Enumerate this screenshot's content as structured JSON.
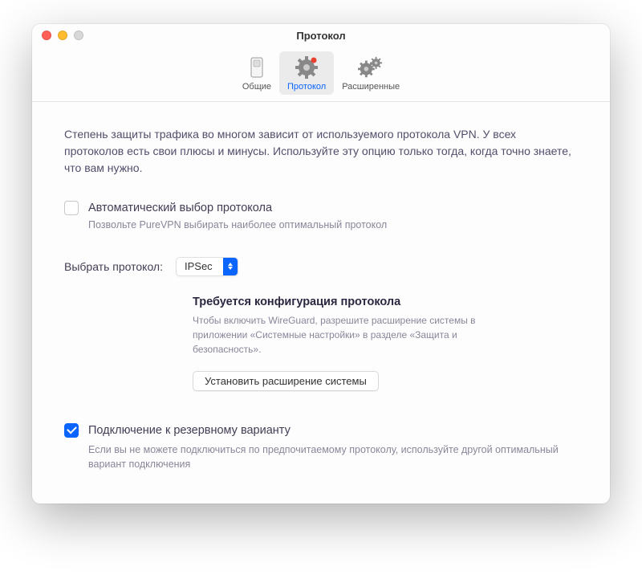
{
  "window": {
    "title": "Протокол"
  },
  "toolbar": {
    "items": [
      {
        "label": "Общие"
      },
      {
        "label": "Протокол"
      },
      {
        "label": "Расширенные"
      }
    ]
  },
  "main": {
    "intro": "Степень защиты трафика во многом зависит от используемого протокола VPN. У всех протоколов есть свои плюсы и минусы. Используйте эту опцию только тогда, когда точно знаете, что вам нужно.",
    "auto_protocol": {
      "label": "Автоматический выбор протокола",
      "desc": "Позвольте PureVPN выбирать наиболее оптимальный протокол",
      "checked": false
    },
    "select": {
      "label": "Выбрать протокол:",
      "value": "IPSec"
    },
    "config": {
      "title": "Требуется конфигурация протокола",
      "desc": "Чтобы включить WireGuard, разрешите расширение системы в приложении «Системные настройки» в разделе «Защита и безопасность».",
      "button": "Установить расширение системы"
    },
    "fallback": {
      "label": "Подключение к резервному варианту",
      "desc": "Если вы не можете подключиться по предпочитаемому протоколу, используйте другой оптимальный вариант подключения",
      "checked": true
    }
  }
}
